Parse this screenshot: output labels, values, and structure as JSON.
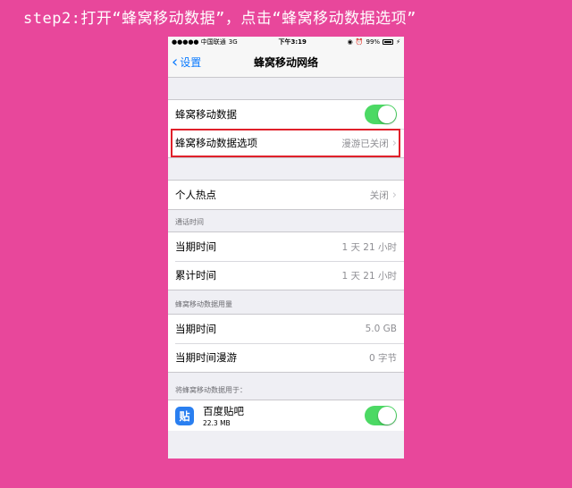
{
  "caption": "step2:打开“蜂窝移动数据”，点击“蜂窝移动数据选项”",
  "status_bar": {
    "carrier": "●●●●● 中国联通",
    "network": "3G",
    "time": "下午3:19",
    "battery": "99%"
  },
  "nav": {
    "back_label": "设置",
    "title": "蜂窝移动网络"
  },
  "group1": {
    "cellular_data_label": "蜂窝移动数据",
    "cellular_data_on": true,
    "options_label": "蜂窝移动数据选项",
    "options_value": "漫游已关闭"
  },
  "hotspot": {
    "label": "个人热点",
    "value": "关闭"
  },
  "call_time": {
    "header": "通话时间",
    "rows": [
      {
        "label": "当期时间",
        "value": "1 天 21 小时"
      },
      {
        "label": "累计时间",
        "value": "1 天 21 小时"
      }
    ]
  },
  "usage": {
    "header": "蜂窝移动数据用量",
    "rows": [
      {
        "label": "当期时间",
        "value": "5.0 GB"
      },
      {
        "label": "当期时间漫游",
        "value": "0 字节"
      }
    ]
  },
  "apps": {
    "header": "将蜂窝移动数据用于：",
    "items": [
      {
        "icon_glyph": "贴",
        "name": "百度贴吧",
        "size": "22.3 MB",
        "enabled": true
      }
    ]
  },
  "colors": {
    "background": "#e8479b",
    "accent": "#0a7aff",
    "switch_on": "#4cd964",
    "highlight": "#e0202a"
  }
}
